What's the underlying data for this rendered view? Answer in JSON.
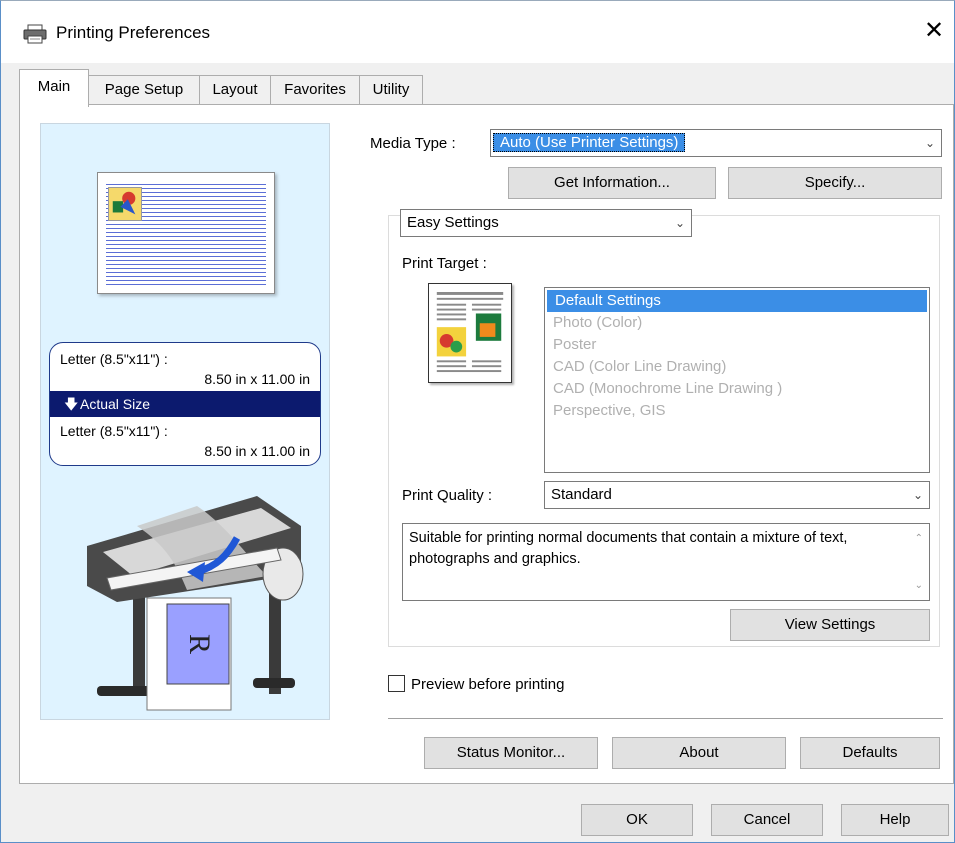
{
  "window": {
    "title": "Printing Preferences"
  },
  "tabs": [
    {
      "label": "Main"
    },
    {
      "label": "Page Setup"
    },
    {
      "label": "Layout"
    },
    {
      "label": "Favorites"
    },
    {
      "label": "Utility"
    }
  ],
  "preview": {
    "original_size_label": "Letter (8.5\"x11\") :",
    "original_size_value": "8.50 in x 11.00 in",
    "scaling_label": "Actual Size",
    "output_size_label": "Letter (8.5\"x11\") :",
    "output_size_value": "8.50 in x 11.00 in",
    "printer_letter": "R"
  },
  "media_type": {
    "label": "Media Type :",
    "value": "Auto (Use Printer Settings)"
  },
  "buttons": {
    "get_information": "Get Information...",
    "specify": "Specify...",
    "view_settings": "View Settings",
    "status_monitor": "Status Monitor...",
    "about": "About",
    "defaults": "Defaults",
    "ok": "OK",
    "cancel": "Cancel",
    "help": "Help"
  },
  "settings_mode": {
    "value": "Easy Settings"
  },
  "print_target": {
    "label": "Print Target :",
    "items": [
      "Default Settings",
      "Photo (Color)",
      "Poster",
      "CAD (Color Line Drawing)",
      "CAD (Monochrome Line Drawing )",
      "Perspective, GIS"
    ]
  },
  "print_quality": {
    "label": "Print Quality :",
    "value": "Standard"
  },
  "description": "Suitable for printing normal documents that contain a mixture of text, photographs and graphics.",
  "preview_checkbox": {
    "label": "Preview before printing",
    "checked": false
  },
  "colors": {
    "accent": "#3b8ee6",
    "preview_bg": "#dff3ff",
    "scaling_bar": "#0c1a6e"
  }
}
